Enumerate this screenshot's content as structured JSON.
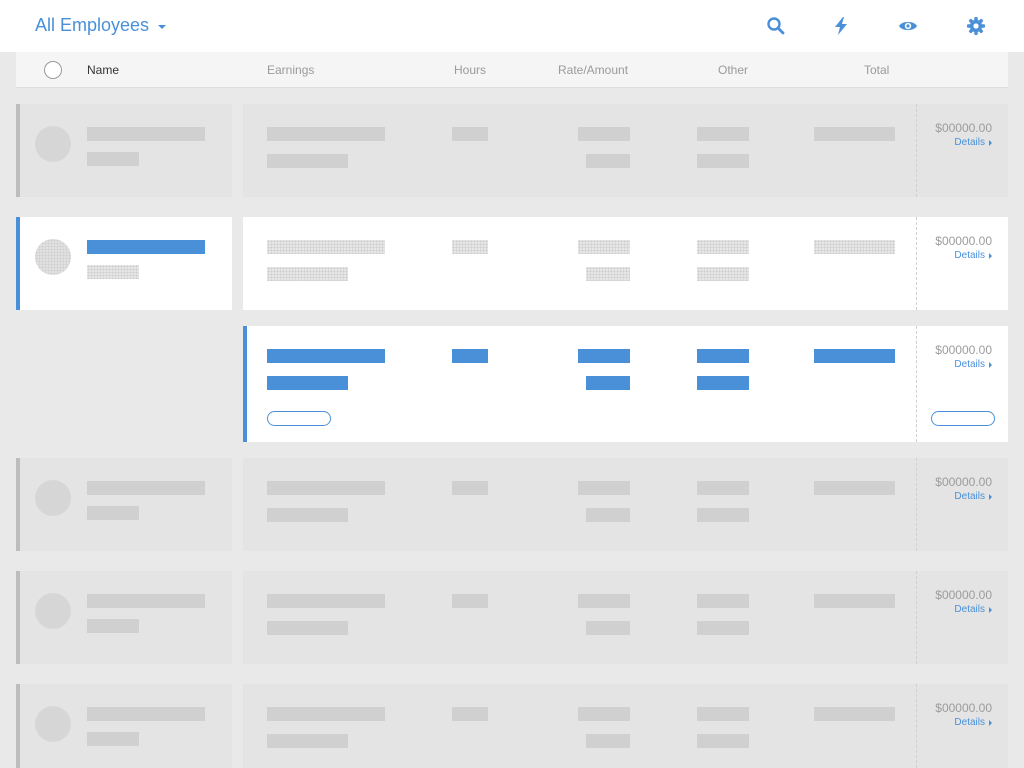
{
  "header": {
    "title": "All Employees",
    "icons": [
      "search-icon",
      "lightning-icon",
      "eye-icon",
      "gear-icon"
    ]
  },
  "columns": {
    "name": "Name",
    "earnings": "Earnings",
    "hours": "Hours",
    "rate": "Rate/Amount",
    "other": "Other",
    "total": "Total"
  },
  "rows": [
    {
      "total": "$00000.00",
      "details": "Details"
    },
    {
      "total": "$00000.00",
      "details": "Details"
    },
    {
      "total": "$00000.00",
      "details": "Details"
    },
    {
      "total": "$00000.00",
      "details": "Details"
    },
    {
      "total": "$00000.00",
      "details": "Details"
    },
    {
      "total": "$00000.00",
      "details": "Details"
    }
  ],
  "colors": {
    "accent": "#4a90d9",
    "background": "#e9e9e9",
    "placeholder": "#d0d0d0"
  }
}
